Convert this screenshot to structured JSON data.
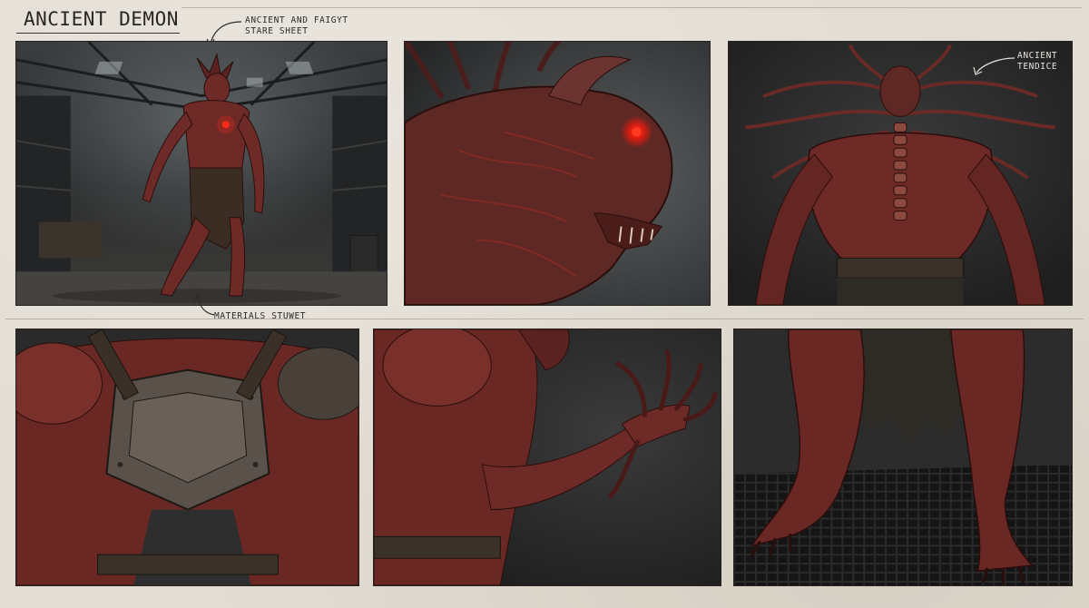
{
  "sheet": {
    "title": "ANCIENT DEMON",
    "annotations": {
      "top_note_line1": "ANCIENT AND FAIGYT",
      "top_note_line2": "STARE SHEET",
      "panel1_caption": "MATERIALS STUWET",
      "panel3_note_line1": "ANCIENT",
      "panel3_note_line2": "TENDICE"
    }
  },
  "colors": {
    "paper": "#e2ddd3",
    "ink": "#2a2520",
    "flesh": "#6e2a26",
    "flesh_dark": "#3a1614",
    "eye_glow": "#ff2a1a",
    "bg_dark": "#2b2b2c"
  },
  "panels": [
    {
      "id": "panel-full-body-warehouse",
      "subject": "full body front view in warehouse"
    },
    {
      "id": "panel-head-closeup",
      "subject": "head profile close-up with glowing red eye"
    },
    {
      "id": "panel-back-view",
      "subject": "back view with tendrils"
    },
    {
      "id": "panel-torso-armor",
      "subject": "chest armor detail"
    },
    {
      "id": "panel-claw-arm",
      "subject": "clawed arm detail"
    },
    {
      "id": "panel-legs-feet",
      "subject": "legs and feet on metal grate"
    }
  ]
}
